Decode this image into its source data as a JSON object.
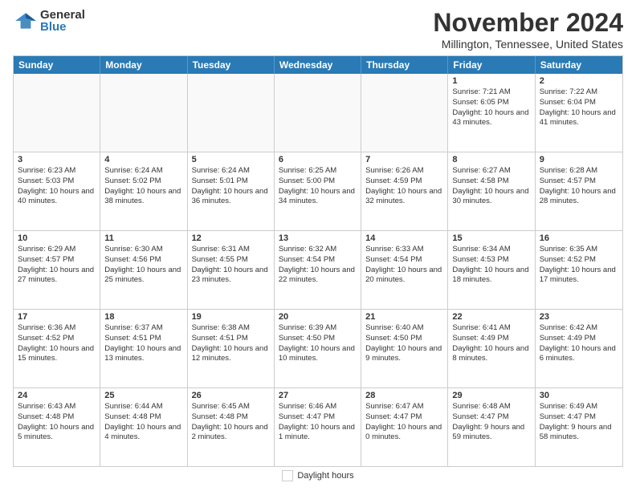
{
  "header": {
    "logo_general": "General",
    "logo_blue": "Blue",
    "month_title": "November 2024",
    "location": "Millington, Tennessee, United States"
  },
  "calendar": {
    "days_of_week": [
      "Sunday",
      "Monday",
      "Tuesday",
      "Wednesday",
      "Thursday",
      "Friday",
      "Saturday"
    ],
    "weeks": [
      [
        {
          "day": "",
          "info": "",
          "empty": true
        },
        {
          "day": "",
          "info": "",
          "empty": true
        },
        {
          "day": "",
          "info": "",
          "empty": true
        },
        {
          "day": "",
          "info": "",
          "empty": true
        },
        {
          "day": "",
          "info": "",
          "empty": true
        },
        {
          "day": "1",
          "info": "Sunrise: 7:21 AM\nSunset: 6:05 PM\nDaylight: 10 hours and 43 minutes.",
          "empty": false
        },
        {
          "day": "2",
          "info": "Sunrise: 7:22 AM\nSunset: 6:04 PM\nDaylight: 10 hours and 41 minutes.",
          "empty": false
        }
      ],
      [
        {
          "day": "3",
          "info": "Sunrise: 6:23 AM\nSunset: 5:03 PM\nDaylight: 10 hours and 40 minutes.",
          "empty": false
        },
        {
          "day": "4",
          "info": "Sunrise: 6:24 AM\nSunset: 5:02 PM\nDaylight: 10 hours and 38 minutes.",
          "empty": false
        },
        {
          "day": "5",
          "info": "Sunrise: 6:24 AM\nSunset: 5:01 PM\nDaylight: 10 hours and 36 minutes.",
          "empty": false
        },
        {
          "day": "6",
          "info": "Sunrise: 6:25 AM\nSunset: 5:00 PM\nDaylight: 10 hours and 34 minutes.",
          "empty": false
        },
        {
          "day": "7",
          "info": "Sunrise: 6:26 AM\nSunset: 4:59 PM\nDaylight: 10 hours and 32 minutes.",
          "empty": false
        },
        {
          "day": "8",
          "info": "Sunrise: 6:27 AM\nSunset: 4:58 PM\nDaylight: 10 hours and 30 minutes.",
          "empty": false
        },
        {
          "day": "9",
          "info": "Sunrise: 6:28 AM\nSunset: 4:57 PM\nDaylight: 10 hours and 28 minutes.",
          "empty": false
        }
      ],
      [
        {
          "day": "10",
          "info": "Sunrise: 6:29 AM\nSunset: 4:57 PM\nDaylight: 10 hours and 27 minutes.",
          "empty": false
        },
        {
          "day": "11",
          "info": "Sunrise: 6:30 AM\nSunset: 4:56 PM\nDaylight: 10 hours and 25 minutes.",
          "empty": false
        },
        {
          "day": "12",
          "info": "Sunrise: 6:31 AM\nSunset: 4:55 PM\nDaylight: 10 hours and 23 minutes.",
          "empty": false
        },
        {
          "day": "13",
          "info": "Sunrise: 6:32 AM\nSunset: 4:54 PM\nDaylight: 10 hours and 22 minutes.",
          "empty": false
        },
        {
          "day": "14",
          "info": "Sunrise: 6:33 AM\nSunset: 4:54 PM\nDaylight: 10 hours and 20 minutes.",
          "empty": false
        },
        {
          "day": "15",
          "info": "Sunrise: 6:34 AM\nSunset: 4:53 PM\nDaylight: 10 hours and 18 minutes.",
          "empty": false
        },
        {
          "day": "16",
          "info": "Sunrise: 6:35 AM\nSunset: 4:52 PM\nDaylight: 10 hours and 17 minutes.",
          "empty": false
        }
      ],
      [
        {
          "day": "17",
          "info": "Sunrise: 6:36 AM\nSunset: 4:52 PM\nDaylight: 10 hours and 15 minutes.",
          "empty": false
        },
        {
          "day": "18",
          "info": "Sunrise: 6:37 AM\nSunset: 4:51 PM\nDaylight: 10 hours and 13 minutes.",
          "empty": false
        },
        {
          "day": "19",
          "info": "Sunrise: 6:38 AM\nSunset: 4:51 PM\nDaylight: 10 hours and 12 minutes.",
          "empty": false
        },
        {
          "day": "20",
          "info": "Sunrise: 6:39 AM\nSunset: 4:50 PM\nDaylight: 10 hours and 10 minutes.",
          "empty": false
        },
        {
          "day": "21",
          "info": "Sunrise: 6:40 AM\nSunset: 4:50 PM\nDaylight: 10 hours and 9 minutes.",
          "empty": false
        },
        {
          "day": "22",
          "info": "Sunrise: 6:41 AM\nSunset: 4:49 PM\nDaylight: 10 hours and 8 minutes.",
          "empty": false
        },
        {
          "day": "23",
          "info": "Sunrise: 6:42 AM\nSunset: 4:49 PM\nDaylight: 10 hours and 6 minutes.",
          "empty": false
        }
      ],
      [
        {
          "day": "24",
          "info": "Sunrise: 6:43 AM\nSunset: 4:48 PM\nDaylight: 10 hours and 5 minutes.",
          "empty": false
        },
        {
          "day": "25",
          "info": "Sunrise: 6:44 AM\nSunset: 4:48 PM\nDaylight: 10 hours and 4 minutes.",
          "empty": false
        },
        {
          "day": "26",
          "info": "Sunrise: 6:45 AM\nSunset: 4:48 PM\nDaylight: 10 hours and 2 minutes.",
          "empty": false
        },
        {
          "day": "27",
          "info": "Sunrise: 6:46 AM\nSunset: 4:47 PM\nDaylight: 10 hours and 1 minute.",
          "empty": false
        },
        {
          "day": "28",
          "info": "Sunrise: 6:47 AM\nSunset: 4:47 PM\nDaylight: 10 hours and 0 minutes.",
          "empty": false
        },
        {
          "day": "29",
          "info": "Sunrise: 6:48 AM\nSunset: 4:47 PM\nDaylight: 9 hours and 59 minutes.",
          "empty": false
        },
        {
          "day": "30",
          "info": "Sunrise: 6:49 AM\nSunset: 4:47 PM\nDaylight: 9 hours and 58 minutes.",
          "empty": false
        }
      ]
    ]
  },
  "legend": {
    "daylight_hours_label": "Daylight hours"
  }
}
